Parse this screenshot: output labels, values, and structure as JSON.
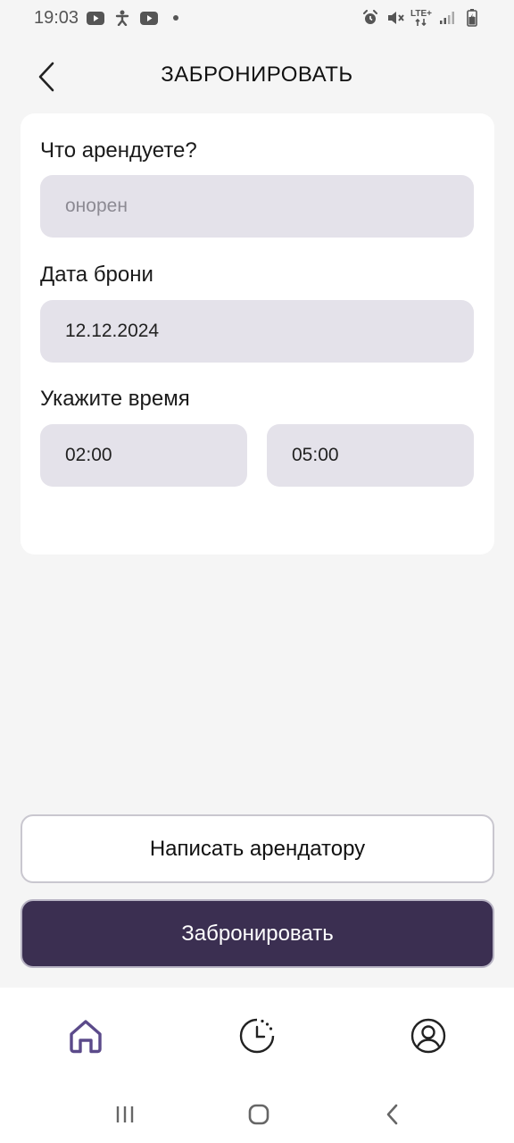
{
  "status_bar": {
    "time": "19:03",
    "network": "LTE+",
    "left_icons": [
      "youtube-icon",
      "accessibility-icon",
      "youtube-icon",
      "dot-icon"
    ],
    "right_icons": [
      "alarm-icon",
      "mute-icon",
      "lte-icon",
      "signal-icon",
      "battery-icon"
    ]
  },
  "header": {
    "title": "ЗАБРОНИРОВАТЬ",
    "back_icon": "chevron-left-icon"
  },
  "form": {
    "what_label": "Что арендуете?",
    "what_placeholder": "онорен",
    "date_label": "Дата брони",
    "date_value": "12.12.2024",
    "time_label": "Укажите время",
    "time_from": "02:00",
    "time_to": "05:00"
  },
  "actions": {
    "message_label": "Написать арендатору",
    "book_label": "Забронировать"
  },
  "bottom_nav": {
    "items": [
      {
        "name": "home",
        "icon": "home-icon",
        "active": true
      },
      {
        "name": "history",
        "icon": "clock-icon",
        "active": false
      },
      {
        "name": "profile",
        "icon": "user-icon",
        "active": false
      }
    ]
  },
  "colors": {
    "accent": "#5b4a8a",
    "primary_button": "#3b2f51",
    "field_bg": "#e4e2ea",
    "page_bg": "#f5f5f5"
  }
}
